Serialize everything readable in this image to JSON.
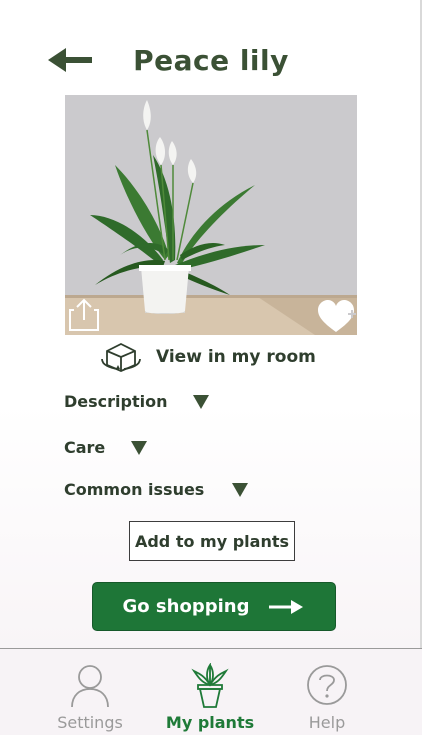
{
  "header": {
    "title": "Peace lily"
  },
  "actions": {
    "view_in_room": "View in my room"
  },
  "sections": [
    {
      "label": "Description"
    },
    {
      "label": "Care"
    },
    {
      "label": "Common issues"
    }
  ],
  "buttons": {
    "add_to_plants": "Add to my plants",
    "go_shopping": "Go shopping"
  },
  "tabs": [
    {
      "label": "Settings",
      "icon": "person-icon",
      "active": false
    },
    {
      "label": "My plants",
      "icon": "potted-plant-icon",
      "active": true
    },
    {
      "label": "Help",
      "icon": "question-icon",
      "active": false
    }
  ],
  "colors": {
    "primary": "#1e7637",
    "heading": "#3b5135",
    "inactive": "#9a9a9a"
  }
}
